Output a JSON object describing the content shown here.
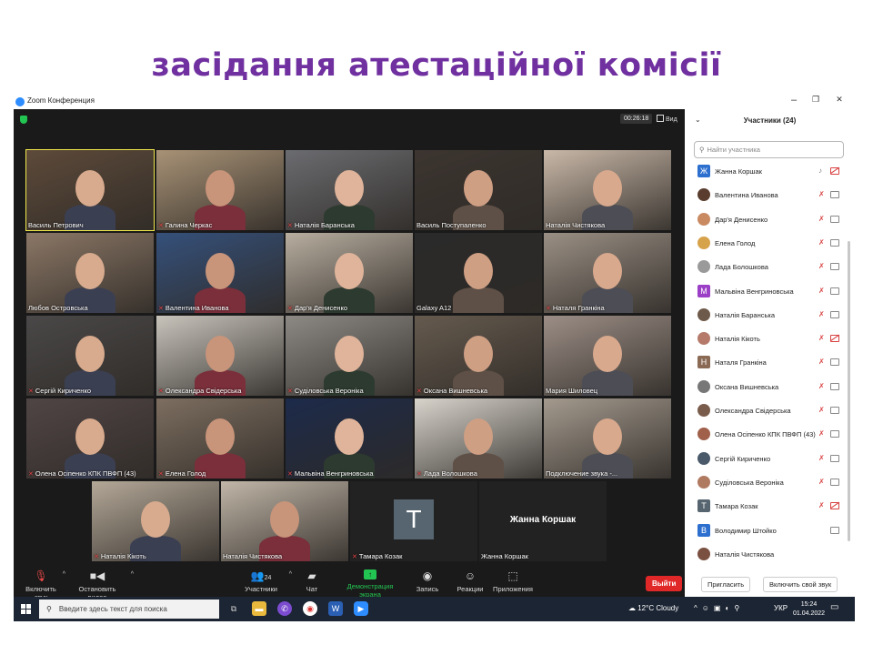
{
  "slide": {
    "title": "засідання атестаційної комісії"
  },
  "window": {
    "title": "Zoom Конференция",
    "min": "–",
    "max": "❐",
    "close": "✕"
  },
  "videobar": {
    "timer": "00:26:18",
    "view": "Вид"
  },
  "tiles": [
    {
      "name": "Василь Петрович",
      "muted": false,
      "active": true
    },
    {
      "name": "Галина Черкас",
      "muted": true
    },
    {
      "name": "Наталія Баранська",
      "muted": true
    },
    {
      "name": "Василь Поступаленко",
      "muted": false
    },
    {
      "name": "Наталія Чистякова",
      "muted": false
    },
    {
      "name": "Любов  Островська",
      "muted": false
    },
    {
      "name": "Валентина Иванова",
      "muted": true
    },
    {
      "name": "Дар'я Денисенко",
      "muted": true
    },
    {
      "name": "Galaxy A12",
      "muted": false
    },
    {
      "name": "Наталя Гранкіна",
      "muted": true
    },
    {
      "name": "Сергій Кириченко",
      "muted": true
    },
    {
      "name": "Олександра Свідерська",
      "muted": true
    },
    {
      "name": "Суділовська Вероніка",
      "muted": true
    },
    {
      "name": "Оксана Вишневська",
      "muted": true
    },
    {
      "name": "Мария Шиловец",
      "muted": false
    },
    {
      "name": "Олена Осіпенко КПК ПВФП (43)",
      "muted": true
    },
    {
      "name": "Елена Голод",
      "muted": true
    },
    {
      "name": "Мальвіна Венгриновська",
      "muted": true
    },
    {
      "name": "Лада Волошкова",
      "muted": true
    },
    {
      "name": "Подключение звука -...",
      "muted": false
    },
    {
      "name": "Наталія Кікоть",
      "muted": true
    },
    {
      "name": "Наталія Чистякова",
      "muted": false
    },
    {
      "name": "Тамара Козак",
      "muted": true,
      "initial": "T"
    },
    {
      "name": "Жанна Коршак",
      "muted": false,
      "bigname": "Жанна Коршак"
    }
  ],
  "controls": {
    "mic": "Включить звук",
    "video": "Остановить видео",
    "participants": "Участники",
    "participants_count": "24",
    "chat": "Чат",
    "share": "Демонстрация экрана",
    "record": "Запись",
    "reactions": "Реакции",
    "apps": "Приложения",
    "leave": "Выйти"
  },
  "panel": {
    "title": "Участники (24)",
    "search_placeholder": "Найти участника",
    "invite": "Пригласить",
    "unmute": "Включить свой звук",
    "participants": [
      {
        "name": "Жанна Коршак",
        "avatar": "Ж",
        "color": "#2d6fcf",
        "mic": "on",
        "cam": "off"
      },
      {
        "name": "Валентина Иванова",
        "avatar": "",
        "color": "#5a3d2e",
        "mic": "off",
        "cam": "on"
      },
      {
        "name": "Дар'я Денисенко",
        "avatar": "",
        "color": "#c98a62",
        "mic": "off",
        "cam": "on"
      },
      {
        "name": "Елена Голод",
        "avatar": "",
        "color": "#d6a24a",
        "mic": "off",
        "cam": "on"
      },
      {
        "name": "Лада Болошкова",
        "avatar": "",
        "color": "#9a9a9a",
        "mic": "off",
        "cam": "on"
      },
      {
        "name": "Мальвіна Венгриновська",
        "avatar": "M",
        "color": "#9b3fc6",
        "mic": "off",
        "cam": "on"
      },
      {
        "name": "Наталія Баранська",
        "avatar": "",
        "color": "#6e5a4a",
        "mic": "off",
        "cam": "on"
      },
      {
        "name": "Наталія Кікоть",
        "avatar": "",
        "color": "#b57a6a",
        "mic": "off",
        "cam": "off"
      },
      {
        "name": "Наталя Гранкіна",
        "avatar": "Н",
        "color": "#8a6a55",
        "mic": "off",
        "cam": "on"
      },
      {
        "name": "Оксана Вишневська",
        "avatar": "",
        "color": "#777777",
        "mic": "off",
        "cam": "on"
      },
      {
        "name": "Олександра Свідерська",
        "avatar": "",
        "color": "#7a5c4c",
        "mic": "off",
        "cam": "on"
      },
      {
        "name": "Олена Осіпенко КПК ПВФП (43)",
        "avatar": "",
        "color": "#a0604a",
        "mic": "off",
        "cam": "on"
      },
      {
        "name": "Сергій Кириченко",
        "avatar": "",
        "color": "#4a5a6a",
        "mic": "off",
        "cam": "on"
      },
      {
        "name": "Суділовська Вероніка",
        "avatar": "",
        "color": "#b07a60",
        "mic": "off",
        "cam": "on"
      },
      {
        "name": "Тамара Козак",
        "avatar": "T",
        "color": "#56656f",
        "mic": "off",
        "cam": "off"
      },
      {
        "name": "Володимир Штойко",
        "avatar": "В",
        "color": "#2d6fcf",
        "mic": "none",
        "cam": "on"
      },
      {
        "name": "Наталія Чистякова",
        "avatar": "",
        "color": "#7a5040",
        "mic": "none",
        "cam": "none"
      }
    ]
  },
  "taskbar": {
    "search_placeholder": "Введите здесь текст для поиска",
    "weather": "12°C  Cloudy",
    "lang": "УКР",
    "time": "15:24",
    "date": "01.04.2022"
  }
}
